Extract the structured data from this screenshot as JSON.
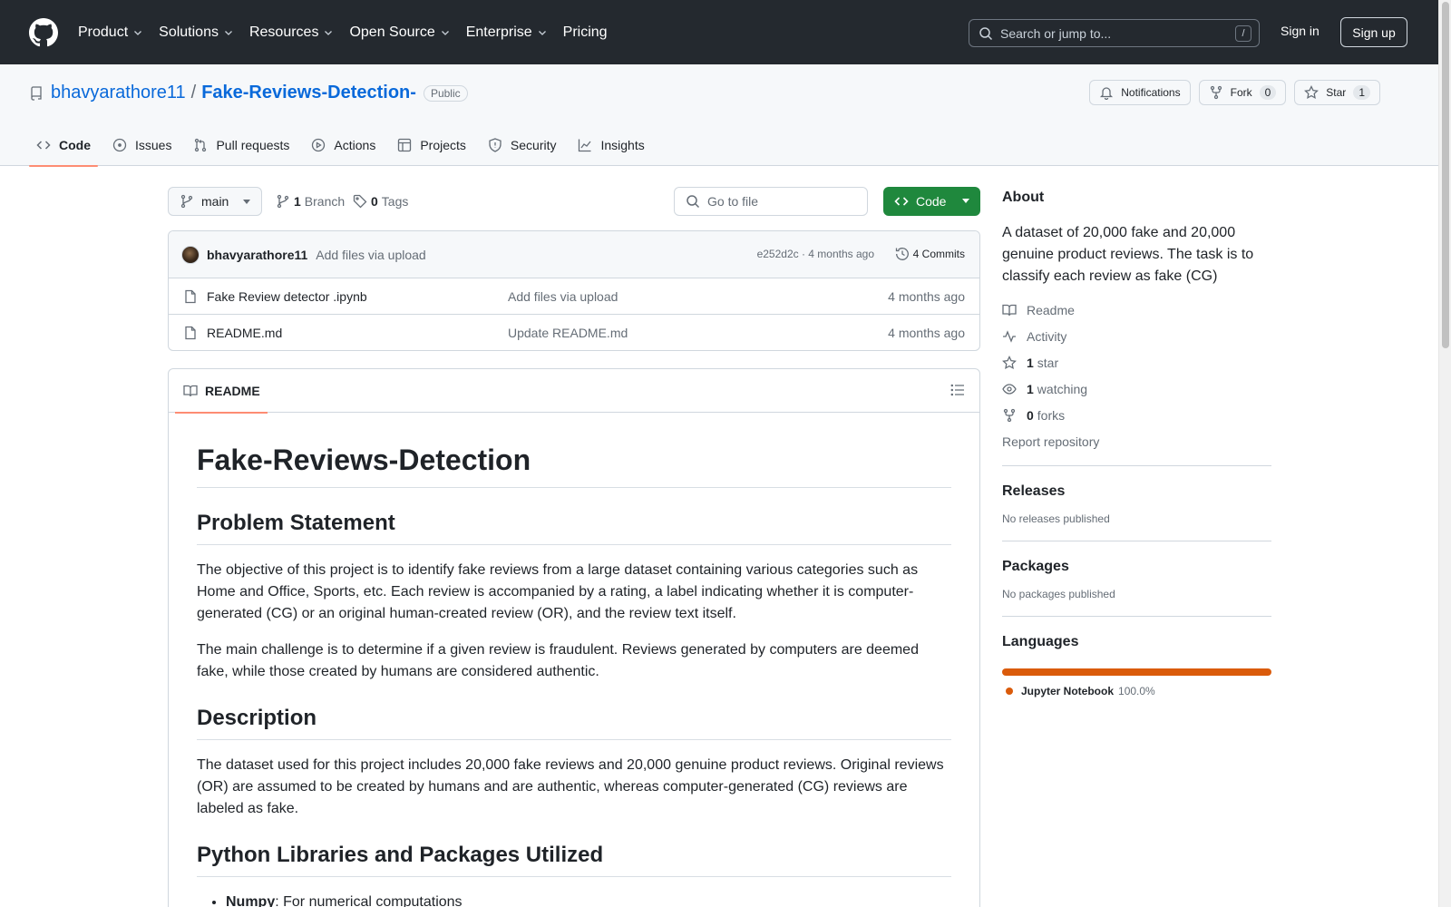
{
  "header": {
    "nav": [
      "Product",
      "Solutions",
      "Resources",
      "Open Source",
      "Enterprise",
      "Pricing"
    ],
    "search_placeholder": "Search or jump to...",
    "search_shortcut": "/",
    "sign_in": "Sign in",
    "sign_up": "Sign up"
  },
  "repo": {
    "owner": "bhavyarathore11",
    "separator": "/",
    "name": "Fake-Reviews-Detection-",
    "visibility": "Public",
    "notifications_label": "Notifications",
    "fork_label": "Fork",
    "fork_count": "0",
    "star_label": "Star",
    "star_count": "1",
    "tabs": [
      "Code",
      "Issues",
      "Pull requests",
      "Actions",
      "Projects",
      "Security",
      "Insights"
    ]
  },
  "file_nav": {
    "branch": "main",
    "branch_count": "1",
    "branch_label": "Branch",
    "tag_count": "0",
    "tag_label": "Tags",
    "goto_placeholder": "Go to file",
    "code_button": "Code"
  },
  "latest_commit": {
    "author": "bhavyarathore11",
    "message": "Add files via upload",
    "meta": "e252d2c · 4 months ago",
    "commits": "4 Commits"
  },
  "files": [
    {
      "name": "Fake Review detector .ipynb",
      "message": "Add files via upload",
      "age": "4 months ago"
    },
    {
      "name": "README.md",
      "message": "Update README.md",
      "age": "4 months ago"
    }
  ],
  "readme": {
    "tab": "README",
    "h1": "Fake-Reviews-Detection",
    "h2_problem": "Problem Statement",
    "p1": "The objective of this project is to identify fake reviews from a large dataset containing various categories such as Home and Office, Sports, etc. Each review is accompanied by a rating, a label indicating whether it is computer-generated (CG) or an original human-created review (OR), and the review text itself.",
    "p2": "The main challenge is to determine if a given review is fraudulent. Reviews generated by computers are deemed fake, while those created by humans are considered authentic.",
    "h2_description": "Description",
    "p3": "The dataset used for this project includes 20,000 fake reviews and 20,000 genuine product reviews. Original reviews (OR) are assumed to be created by humans and are authentic, whereas computer-generated (CG) reviews are labeled as fake.",
    "h2_libraries": "Python Libraries and Packages Utilized",
    "list": [
      {
        "name": "Numpy",
        "desc": ": For numerical computations"
      }
    ]
  },
  "sidebar": {
    "about_title": "About",
    "about_desc": "A dataset of 20,000 fake and 20,000 genuine product reviews. The task is to classify each review as fake (CG)",
    "readme": "Readme",
    "activity": "Activity",
    "stars_count": "1",
    "stars_label": "star",
    "watching_count": "1",
    "watching_label": "watching",
    "forks_count": "0",
    "forks_label": "forks",
    "report": "Report repository",
    "releases_title": "Releases",
    "releases_text": "No releases published",
    "packages_title": "Packages",
    "packages_text": "No packages published",
    "languages_title": "Languages",
    "language_name": "Jupyter Notebook",
    "language_pct": "100.0%",
    "language_share": 100,
    "language_color": "#da5b0b"
  },
  "colors": {
    "header_bg": "#24292f",
    "link": "#0969da",
    "primary_button": "#1f883d",
    "tab_underline": "#fd8c73"
  }
}
